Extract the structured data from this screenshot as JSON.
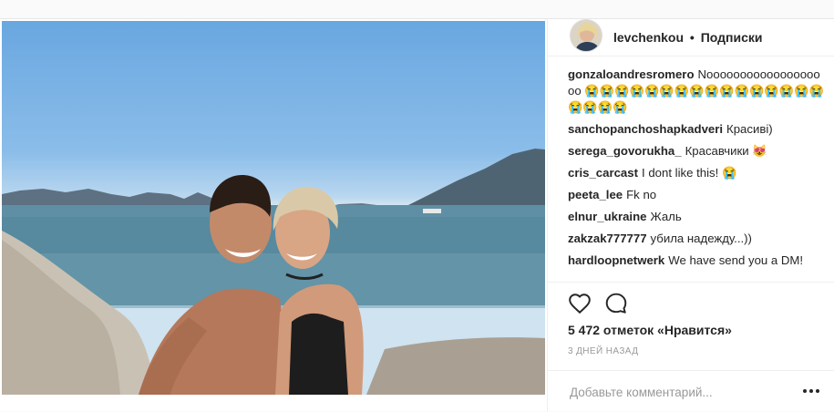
{
  "post": {
    "username": "levchenkou",
    "separator": "•",
    "follow_label": "Подписки"
  },
  "comments": [
    {
      "user": "gonzaloandresromero",
      "text": "Nooooooooooooooooooo 😭😭😭😭😭😭😭😭😭😭😭😭😭😭😭😭😭😭😭😭"
    },
    {
      "user": "sanchopanchoshapkadveri",
      "text": "Красиві)"
    },
    {
      "user": "serega_govorukha_",
      "text": "Красавчики 😻"
    },
    {
      "user": "cris_carcast",
      "text": "I dont like this! 😭"
    },
    {
      "user": "peeta_lee",
      "text": "Fk no"
    },
    {
      "user": "elnur_ukraine",
      "text": "Жаль"
    },
    {
      "user": "zakzak777777",
      "text": "убила надежду...))"
    },
    {
      "user": "hardloopnetwerk",
      "text": "We have send you a DM!"
    }
  ],
  "likes": "5 472 отметок «Нравится»",
  "time_ago": "3 дней назад",
  "add_comment": {
    "placeholder": "Добавьте комментарий..."
  },
  "icons": {
    "like": "heart-icon",
    "comment": "speech-bubble-icon",
    "more": "ellipsis-icon"
  },
  "colors": {
    "text": "#262626",
    "muted": "#999999",
    "border": "#efefef",
    "sky": "#8bbde9",
    "sea": "#4a7f94"
  }
}
